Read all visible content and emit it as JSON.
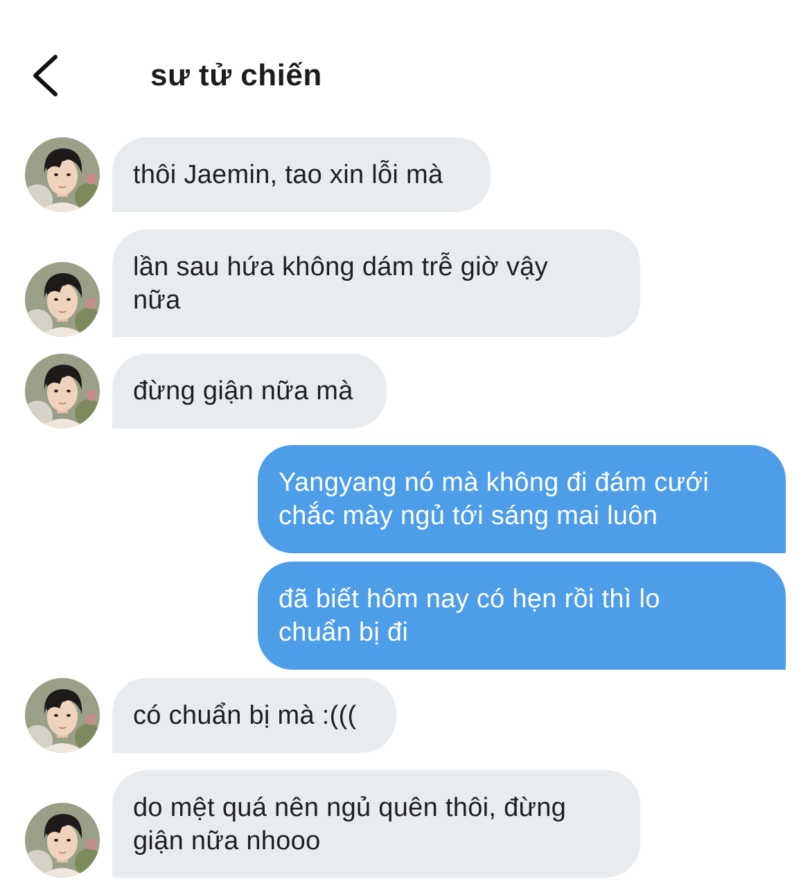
{
  "header": {
    "title": "sư tử chiến",
    "back_icon": "chevron-left-icon"
  },
  "colors": {
    "incoming_bubble": "#e9ecef",
    "outgoing_bubble": "#4d9de8",
    "outgoing_text": "#ffffff",
    "incoming_text": "#1f1f21"
  },
  "messages": [
    {
      "sender": "them",
      "text": "thôi Jaemin, tao xin lỗi mà"
    },
    {
      "sender": "them",
      "text": "lần sau hứa không dám trễ giờ vậy nữa"
    },
    {
      "sender": "them",
      "text": "đừng giận nữa mà"
    },
    {
      "sender": "me",
      "text": "Yangyang nó mà không đi đám cưới chắc mày ngủ tới sáng mai luôn"
    },
    {
      "sender": "me",
      "text": "đã biết hôm nay có hẹn rồi thì lo chuẩn bị đi"
    },
    {
      "sender": "them",
      "text": "có chuẩn bị mà :((("
    },
    {
      "sender": "them",
      "text": "do mệt quá nên ngủ quên thôi, đừng giận nữa nhooo"
    }
  ]
}
